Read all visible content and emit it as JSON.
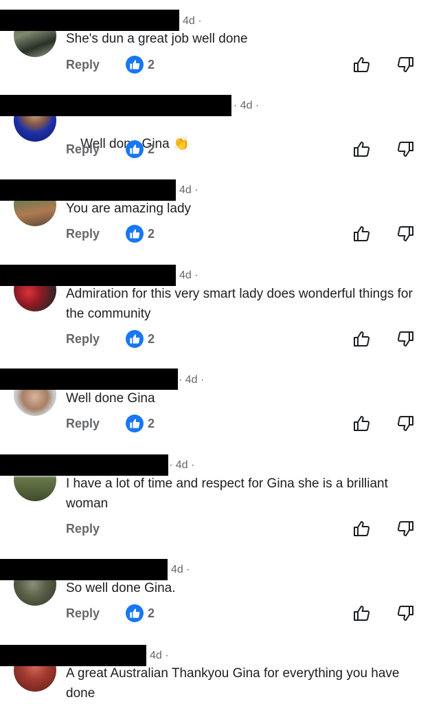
{
  "comments": [
    {
      "time": "4d ·",
      "text": "She's dun a great job well done",
      "reply": "Reply",
      "likes": "2"
    },
    {
      "time": "· 4d ·",
      "text": "Well done Gina",
      "emoji": "👏",
      "reply": "Reply",
      "likes": "2"
    },
    {
      "time": "4d ·",
      "text": "You are amazing lady",
      "reply": "Reply",
      "likes": "2"
    },
    {
      "time": "4d ·",
      "text": "Admiration for this very smart lady does wonderful things for the community",
      "reply": "Reply",
      "likes": "2"
    },
    {
      "time": "· 4d ·",
      "text": "Well done Gina",
      "reply": "Reply",
      "likes": "2"
    },
    {
      "time": "· 4d ·",
      "text": "I have a lot of time and respect for Gina she is a brilliant woman",
      "reply": "Reply"
    },
    {
      "time": "4d ·",
      "text": "So well done Gina.",
      "reply": "Reply",
      "likes": "2"
    },
    {
      "time": "4d ·",
      "text": "A great Australian Thankyou Gina for everything you have done"
    }
  ],
  "icons": {
    "like_badge": "thumbs-up-filled-icon",
    "upvote": "thumbs-up-outline-icon",
    "downvote": "thumbs-down-outline-icon"
  },
  "colors": {
    "like_blue": "#1877f2",
    "meta_gray": "#65676b",
    "text": "#1c1e21"
  }
}
